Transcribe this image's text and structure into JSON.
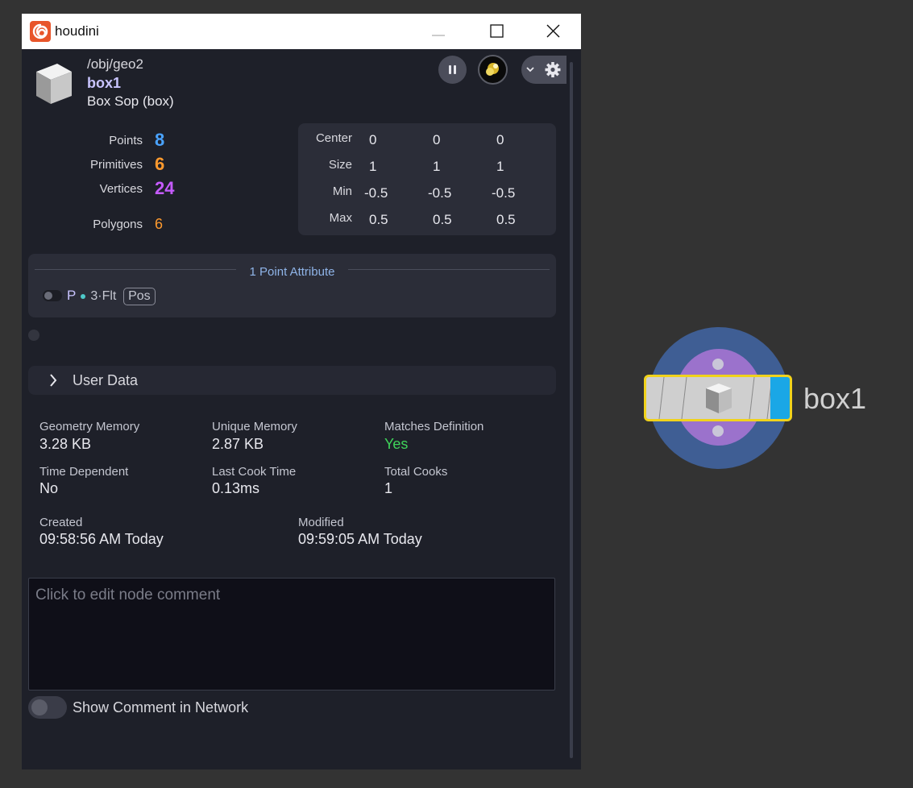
{
  "window": {
    "title": "houdini"
  },
  "header": {
    "path": "/obj/geo2",
    "node_name": "box1",
    "node_type": "Box Sop (box)"
  },
  "stats": [
    {
      "label": "Points",
      "value": "8",
      "color": "#4aa3ff"
    },
    {
      "label": "Primitives",
      "value": "6",
      "color": "#ff9a2e"
    },
    {
      "label": "Vertices",
      "value": "24",
      "color": "#c55bff"
    },
    {
      "label": "Polygons",
      "value": "6",
      "color": "#ff9a2e"
    }
  ],
  "bounds": {
    "rows": [
      {
        "label": "Center",
        "values": [
          "0",
          "0",
          "0"
        ]
      },
      {
        "label": "Size",
        "values": [
          "1",
          "1",
          "1"
        ]
      },
      {
        "label": "Min",
        "values": [
          "-0.5",
          "-0.5",
          "-0.5"
        ]
      },
      {
        "label": "Max",
        "values": [
          "0.5",
          "0.5",
          "0.5"
        ]
      }
    ]
  },
  "attributes": {
    "title": "1 Point Attribute",
    "items": [
      {
        "name": "P",
        "type": "3·Flt",
        "tag": "Pos"
      }
    ]
  },
  "user_data": {
    "label": "User Data"
  },
  "info": {
    "geometry_memory": {
      "label": "Geometry Memory",
      "value": "3.28 KB"
    },
    "unique_memory": {
      "label": "Unique Memory",
      "value": "2.87 KB"
    },
    "matches_definition": {
      "label": "Matches Definition",
      "value": "Yes",
      "color": "#3fd35a"
    },
    "time_dependent": {
      "label": "Time Dependent",
      "value": "No"
    },
    "last_cook_time": {
      "label": "Last Cook Time",
      "value": "0.13ms"
    },
    "total_cooks": {
      "label": "Total Cooks",
      "value": "1"
    },
    "created": {
      "label": "Created",
      "value": "09:58:56 AM Today"
    },
    "modified": {
      "label": "Modified",
      "value": "09:59:05 AM Today"
    }
  },
  "comment": {
    "placeholder": "Click to edit node comment",
    "value": ""
  },
  "show_comment": {
    "label": "Show Comment in Network",
    "enabled": false
  },
  "network": {
    "node_label": "box1"
  },
  "colors": {
    "accent_purple": "#c9c4ff",
    "node_ring": "#3f5e94",
    "node_selected": "#f0d21c",
    "node_flag": "#1aa7e6"
  }
}
